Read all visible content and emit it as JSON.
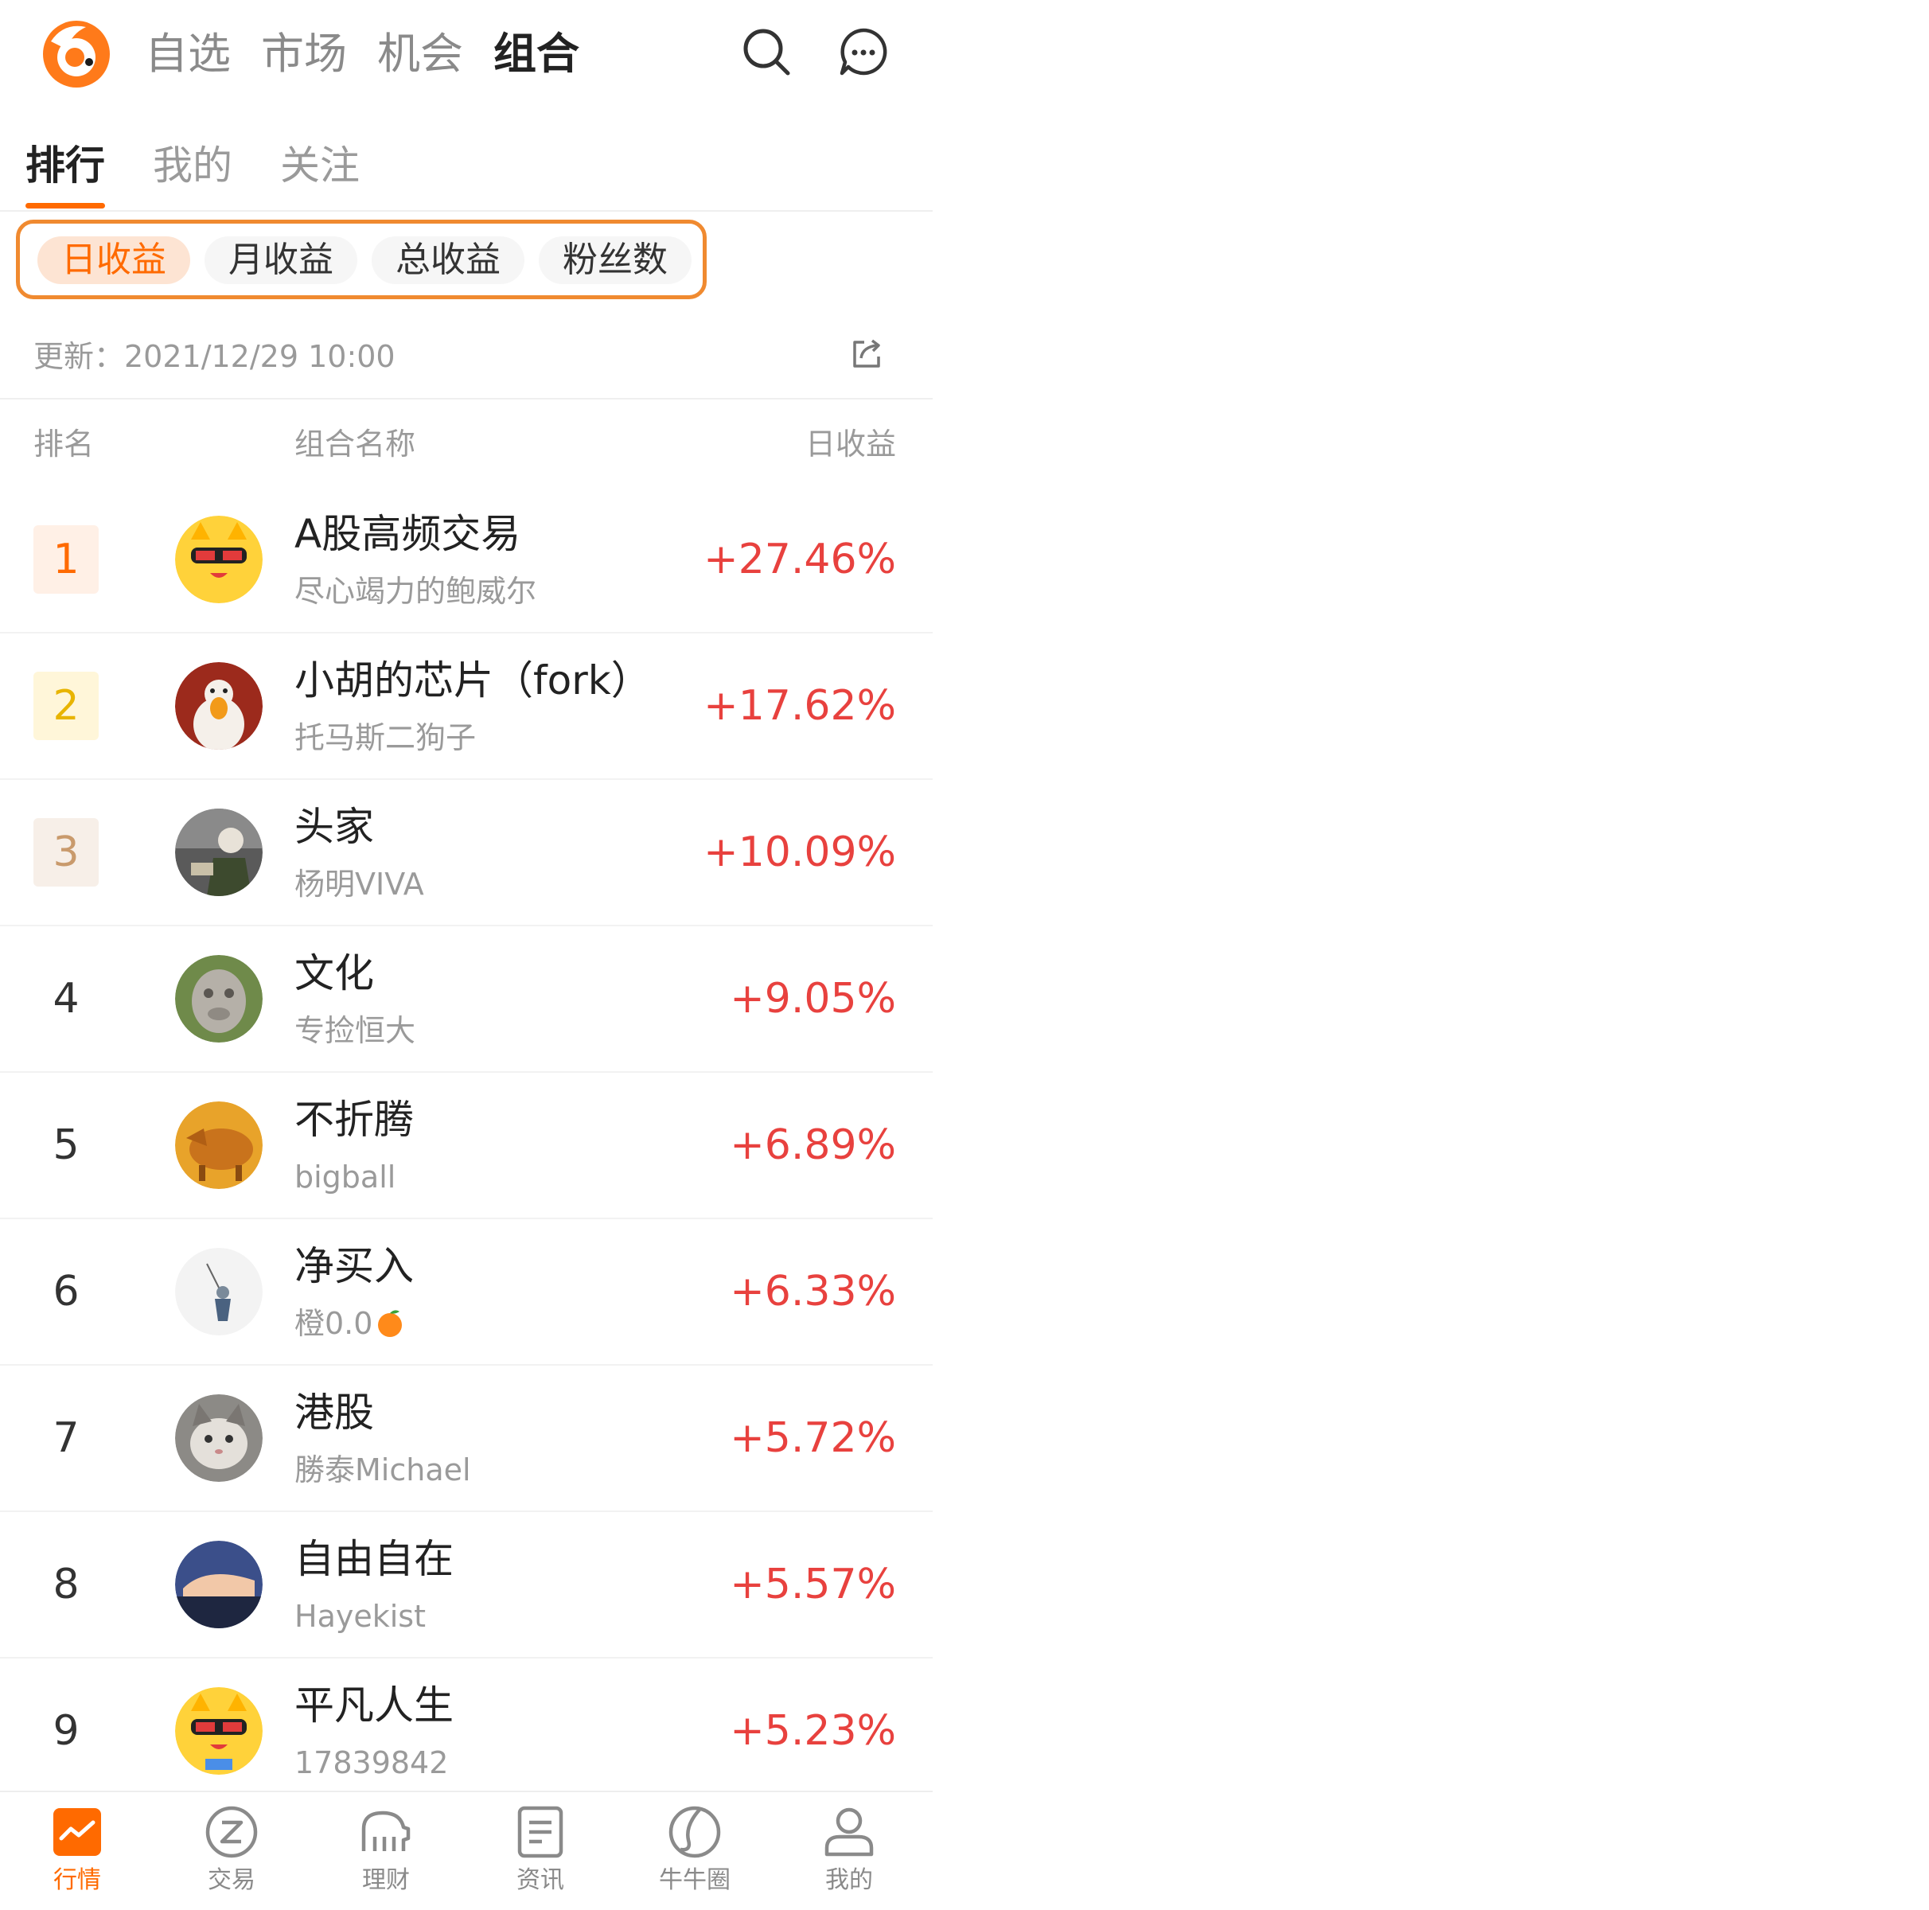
{
  "header": {
    "tabs": [
      "自选",
      "市场",
      "机会",
      "组合"
    ],
    "active_tab": "组合"
  },
  "subtabs": [
    "排行",
    "我的",
    "关注"
  ],
  "filters": [
    "日收益",
    "月收益",
    "总收益",
    "粉丝数"
  ],
  "update_text": "更新：2021/12/29 10:00",
  "columns": {
    "rank": "排名",
    "name": "组合名称",
    "gain": "日收益"
  },
  "rows": [
    {
      "rank": "1",
      "name": "A股高频交易",
      "owner": "尽心竭力的鲍威尔",
      "gain": "+27.46%"
    },
    {
      "rank": "2",
      "name": "小胡的芯片（fork）",
      "owner": "托马斯二狗子",
      "gain": "+17.62%"
    },
    {
      "rank": "3",
      "name": "头家",
      "owner": "杨明VIVA",
      "gain": "+10.09%"
    },
    {
      "rank": "4",
      "name": "文化",
      "owner": "专捡恒大",
      "gain": "+9.05%"
    },
    {
      "rank": "5",
      "name": "不折腾",
      "owner": "bigball",
      "gain": "+6.89%"
    },
    {
      "rank": "6",
      "name": "净买入",
      "owner": "橙0.0",
      "gain": "+6.33%"
    },
    {
      "rank": "7",
      "name": "港股",
      "owner": "勝泰Michael",
      "gain": "+5.72%"
    },
    {
      "rank": "8",
      "name": "自由自在",
      "owner": "Hayekist",
      "gain": "+5.57%"
    },
    {
      "rank": "9",
      "name": "平凡人生",
      "owner": "17839842",
      "gain": "+5.23%"
    }
  ],
  "bottom_nav": [
    "行情",
    "交易",
    "理财",
    "资讯",
    "牛牛圈",
    "我的"
  ],
  "colors": {
    "accent": "#ff6a00",
    "gain": "#e8413e"
  }
}
